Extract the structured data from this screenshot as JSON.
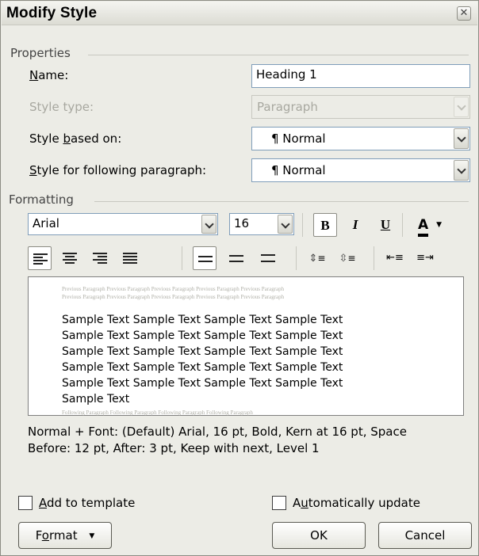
{
  "title": "Modify Style",
  "properties": {
    "group_label": "Properties",
    "name_label": "Name:",
    "name_value": "Heading 1",
    "style_type_label": "Style type:",
    "style_type_value": "Paragraph",
    "based_on_label": "Style based on:",
    "based_on_value": "¶ Normal",
    "following_label": "Style for following paragraph:",
    "following_value": "¶ Normal"
  },
  "formatting": {
    "group_label": "Formatting",
    "font_name": "Arial",
    "font_size": "16",
    "bold": "B",
    "italic": "I",
    "underline": "U",
    "font_color": "A"
  },
  "preview": {
    "previous_paragraph": [
      "Previous Paragraph Previous Paragraph Previous Paragraph Previous Paragraph Previous Paragraph",
      "Previous Paragraph Previous Paragraph Previous Paragraph Previous Paragraph Previous Paragraph"
    ],
    "sample_lines": [
      "Sample Text Sample Text Sample Text Sample Text",
      "Sample Text Sample Text Sample Text Sample Text",
      "Sample Text Sample Text Sample Text Sample Text",
      "Sample Text Sample Text Sample Text Sample Text",
      "Sample Text Sample Text Sample Text Sample Text",
      "Sample Text"
    ],
    "following_paragraph": "Following Paragraph Following Paragraph Following Paragraph Following Paragraph"
  },
  "description": [
    "Normal + Font: (Default) Arial, 16 pt, Bold, Kern at 16 pt, Space",
    "Before:  12 pt, After:  3 pt, Keep with next, Level 1"
  ],
  "options": {
    "add_to_template": "Add to template",
    "automatically_update": "Automatically update"
  },
  "buttons": {
    "format": "Format",
    "ok": "OK",
    "cancel": "Cancel"
  }
}
